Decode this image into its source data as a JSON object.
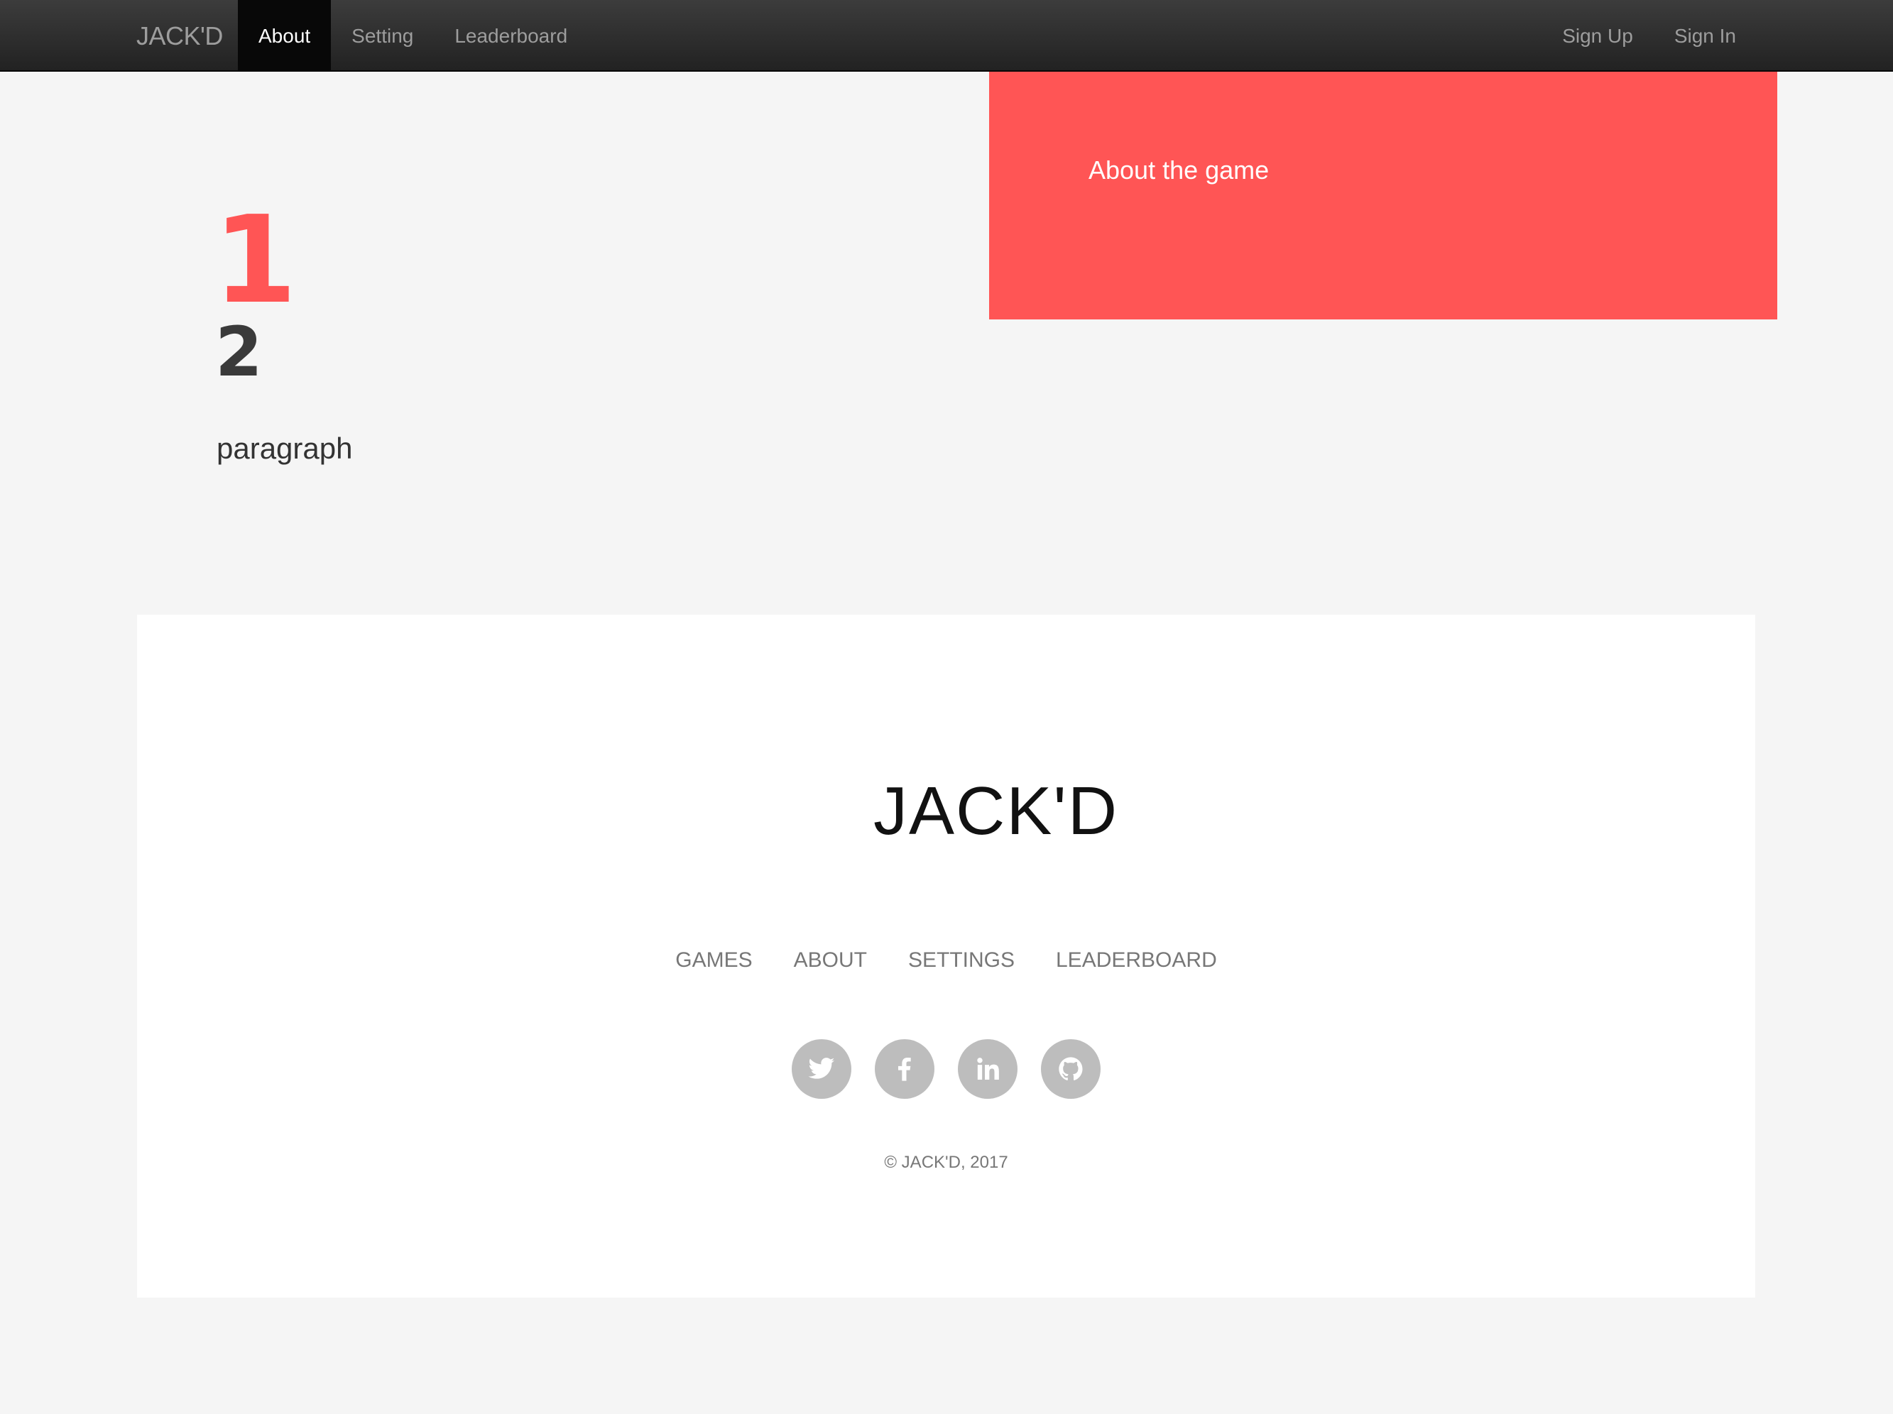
{
  "navbar": {
    "brand": "JACK'D",
    "left_items": [
      {
        "label": "About",
        "active": true
      },
      {
        "label": "Setting",
        "active": false
      },
      {
        "label": "Leaderboard",
        "active": false
      }
    ],
    "right_items": [
      {
        "label": "Sign Up"
      },
      {
        "label": "Sign In"
      }
    ]
  },
  "hero": {
    "number_one": "1",
    "number_two": "2",
    "paragraph": "paragraph",
    "about_box_title": "About the game",
    "accent_color": "#ff5555"
  },
  "footer": {
    "logo": "JACK'D",
    "links": [
      "GAMES",
      "ABOUT",
      "SETTINGS",
      "LEADERBOARD"
    ],
    "social": [
      {
        "icon": "twitter-icon"
      },
      {
        "icon": "facebook-icon"
      },
      {
        "icon": "linkedin-icon"
      },
      {
        "icon": "github-icon"
      }
    ],
    "copyright": "© JACK'D, 2017"
  }
}
